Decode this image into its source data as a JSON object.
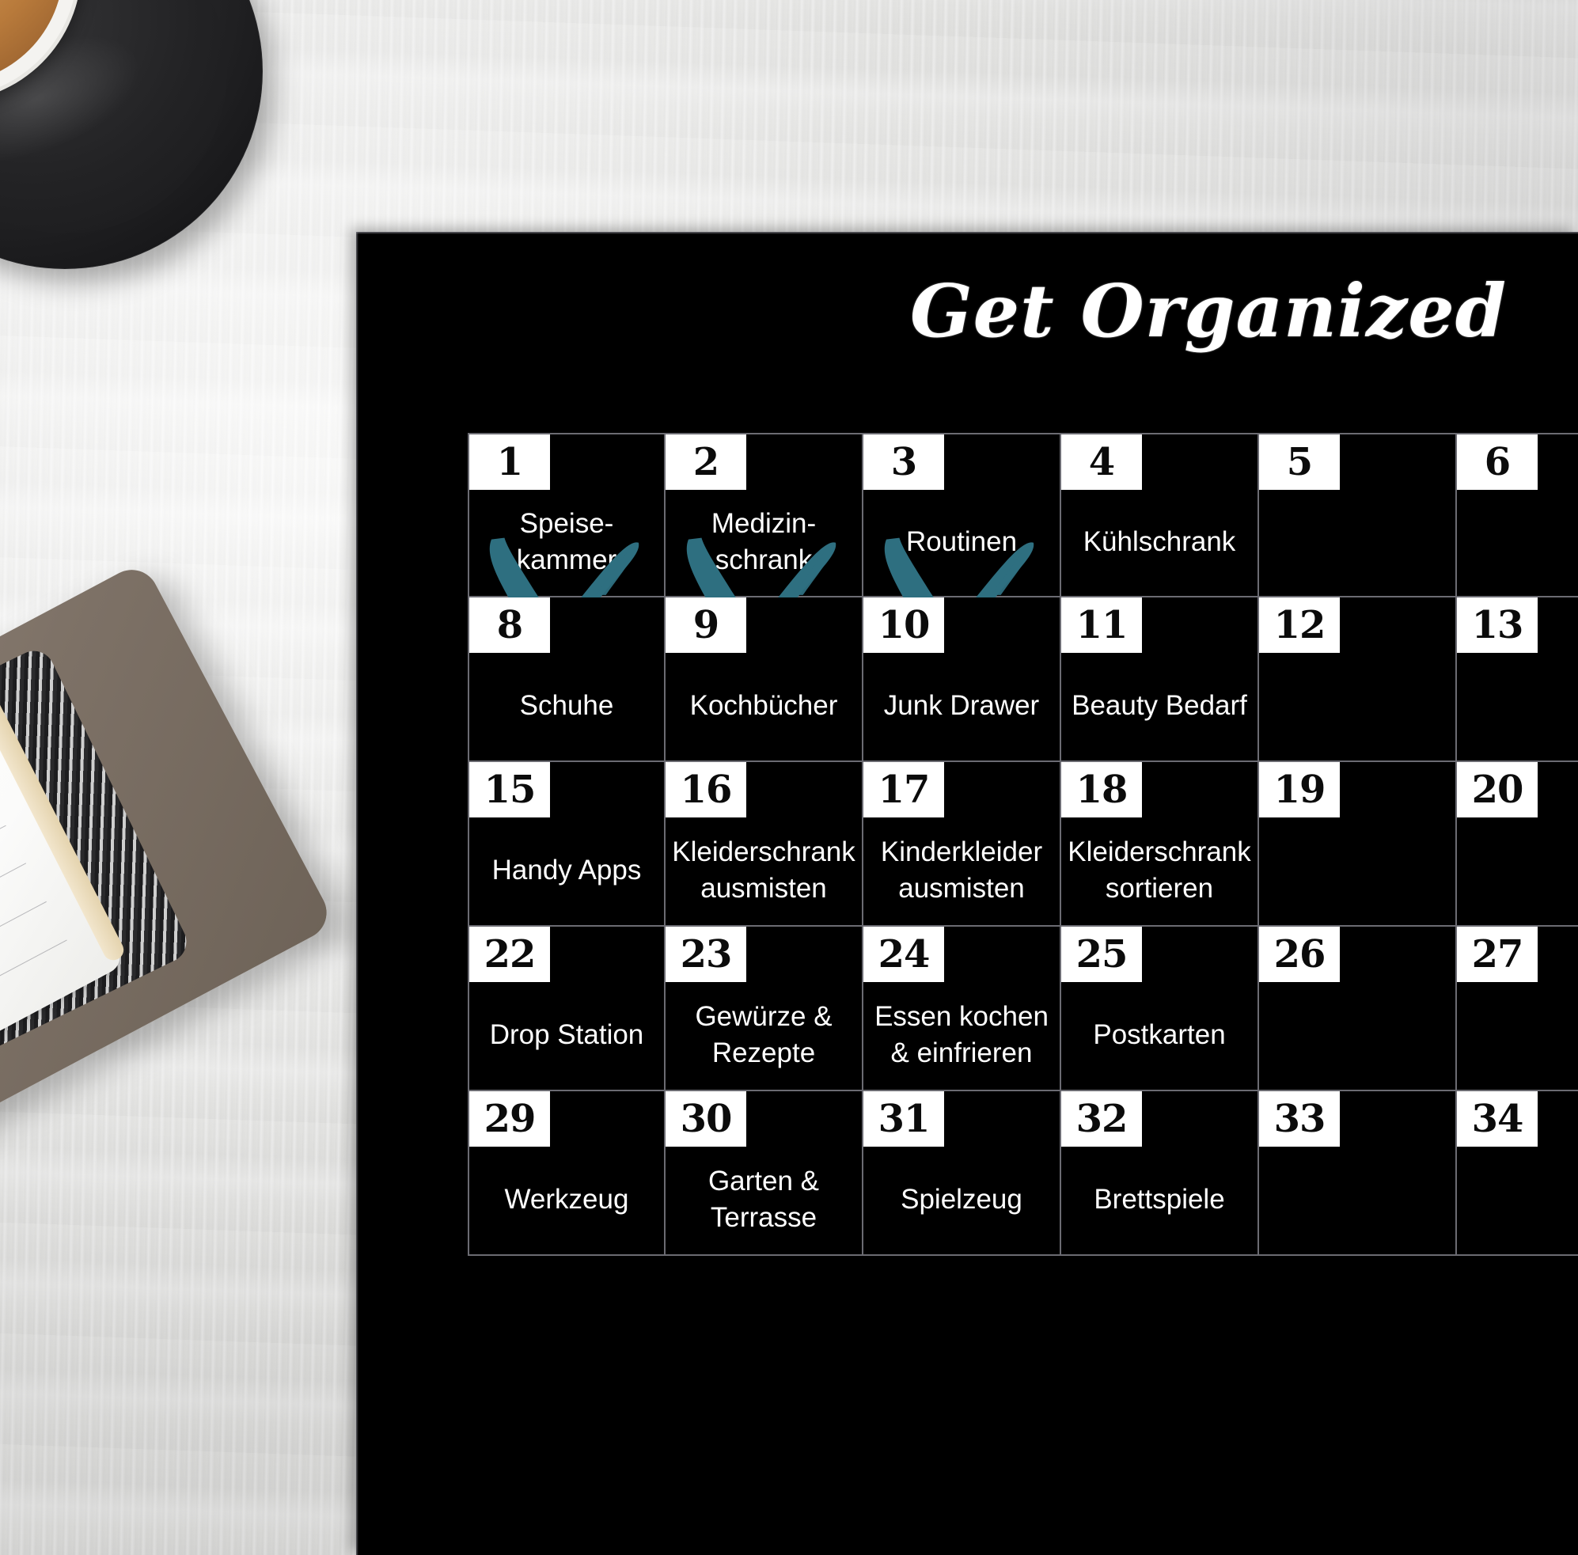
{
  "scene": {
    "background_objects": [
      {
        "name": "coffee-cup",
        "label": "coffee cup on black saucer"
      },
      {
        "name": "notebook",
        "label": "closed notebook with lined pages"
      }
    ],
    "desk_color": "#f2f2f1"
  },
  "poster": {
    "title": "Get Organized",
    "background_color": "#000000",
    "grid_line_color": "#6b6b72",
    "number_badge_bg": "#ffffff",
    "number_badge_fg": "#0b0b0b",
    "task_text_color": "#ffffff",
    "x_mark_color": "#2e6f80"
  },
  "calendar": {
    "columns": 6,
    "rows": [
      {
        "cells": [
          {
            "number": "1",
            "task": "Speise-\nkammer",
            "crossed": true
          },
          {
            "number": "2",
            "task": "Medizin-\nschrank",
            "crossed": true
          },
          {
            "number": "3",
            "task": "Routinen",
            "crossed": true
          },
          {
            "number": "4",
            "task": "Kühlschrank",
            "crossed": false
          },
          {
            "number": "5",
            "task": "",
            "crossed": false
          },
          {
            "number": "6",
            "task": "",
            "crossed": false
          }
        ]
      },
      {
        "cells": [
          {
            "number": "8",
            "task": "Schuhe",
            "crossed": false
          },
          {
            "number": "9",
            "task": "Kochbücher",
            "crossed": false
          },
          {
            "number": "10",
            "task": "Junk Drawer",
            "crossed": false
          },
          {
            "number": "11",
            "task": "Beauty Bedarf",
            "crossed": false
          },
          {
            "number": "12",
            "task": "",
            "crossed": false
          },
          {
            "number": "13",
            "task": "",
            "crossed": false
          }
        ]
      },
      {
        "cells": [
          {
            "number": "15",
            "task": "Handy Apps",
            "crossed": false
          },
          {
            "number": "16",
            "task": "Kleiderschrank\nausmisten",
            "crossed": false
          },
          {
            "number": "17",
            "task": "Kinderkleider\nausmisten",
            "crossed": false
          },
          {
            "number": "18",
            "task": "Kleiderschrank\nsortieren",
            "crossed": false
          },
          {
            "number": "19",
            "task": "",
            "crossed": false
          },
          {
            "number": "20",
            "task": "",
            "crossed": false
          }
        ]
      },
      {
        "cells": [
          {
            "number": "22",
            "task": "Drop Station",
            "crossed": false
          },
          {
            "number": "23",
            "task": "Gewürze &\nRezepte",
            "crossed": false
          },
          {
            "number": "24",
            "task": "Essen kochen\n& einfrieren",
            "crossed": false
          },
          {
            "number": "25",
            "task": "Postkarten",
            "crossed": false
          },
          {
            "number": "26",
            "task": "",
            "crossed": false
          },
          {
            "number": "27",
            "task": "",
            "crossed": false
          }
        ]
      },
      {
        "cells": [
          {
            "number": "29",
            "task": "Werkzeug",
            "crossed": false
          },
          {
            "number": "30",
            "task": "Garten &\nTerrasse",
            "crossed": false
          },
          {
            "number": "31",
            "task": "Spielzeug",
            "crossed": false
          },
          {
            "number": "32",
            "task": "Brettspiele",
            "crossed": false
          },
          {
            "number": "33",
            "task": "",
            "crossed": false
          },
          {
            "number": "34",
            "task": "",
            "crossed": false
          }
        ]
      }
    ]
  }
}
